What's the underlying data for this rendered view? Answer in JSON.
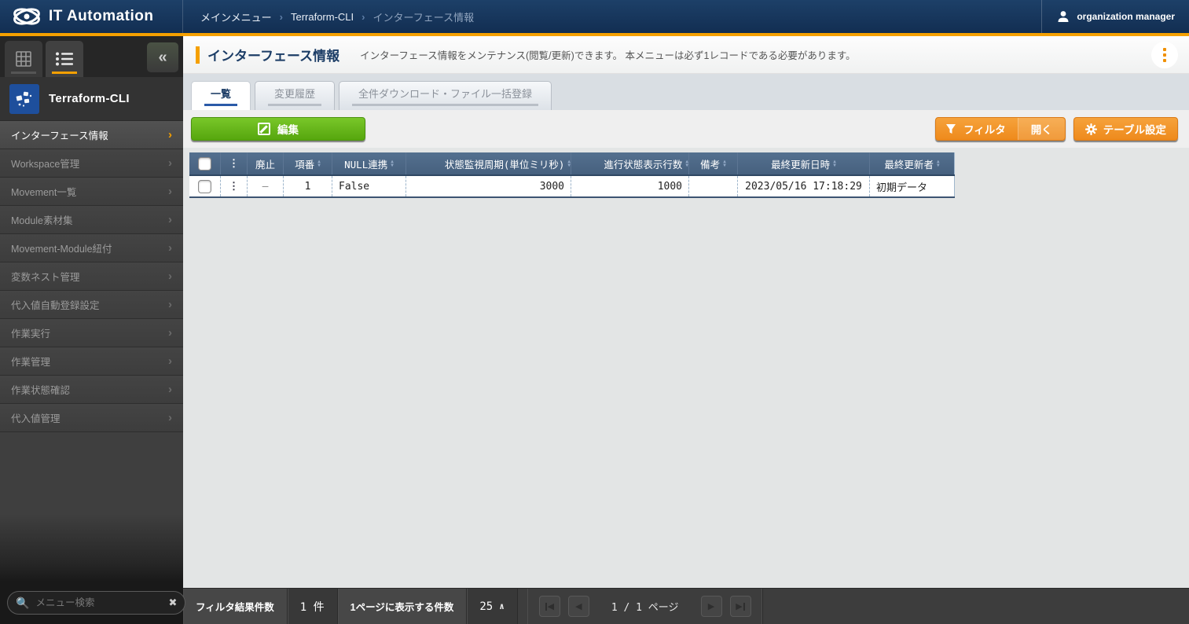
{
  "header": {
    "app_title": "IT Automation",
    "breadcrumb": {
      "item1": "メインメニュー",
      "item2": "Terraform-CLI",
      "item3": "インターフェース情報",
      "sep": "›"
    },
    "user_name": "organization manager"
  },
  "sidebar": {
    "workspace_title": "Terraform-CLI",
    "collapse_glyph": "«",
    "search_placeholder": "メニュー検索",
    "items": [
      {
        "label": "インターフェース情報"
      },
      {
        "label": "Workspace管理"
      },
      {
        "label": "Movement一覧"
      },
      {
        "label": "Module素材集"
      },
      {
        "label": "Movement-Module紐付"
      },
      {
        "label": "変数ネスト管理"
      },
      {
        "label": "代入値自動登録設定"
      },
      {
        "label": "作業実行"
      },
      {
        "label": "作業管理"
      },
      {
        "label": "作業状態確認"
      },
      {
        "label": "代入値管理"
      }
    ],
    "chevron": "›"
  },
  "page": {
    "title": "インターフェース情報",
    "description": "インターフェース情報をメンテナンス(閲覧/更新)できます。 本メニューは必ず1レコードである必要があります。",
    "tabs": [
      {
        "label": "一覧"
      },
      {
        "label": "変更履歴"
      },
      {
        "label": "全件ダウンロード・ファイル一括登録"
      }
    ],
    "edit_button": "編集",
    "filter_button": "フィルタ",
    "filter_open_button": "開く",
    "table_settings_button": "テーブル設定"
  },
  "table": {
    "columns": {
      "discard": "廃止",
      "no": "項番",
      "null_link": "NULL連携",
      "monitor_cycle": "状態監視周期(単位ミリ秒)",
      "progress_rows": "進行状態表示行数",
      "remarks": "備考",
      "last_update": "最終更新日時",
      "last_updater": "最終更新者"
    },
    "kebab_glyph": "⋮",
    "sort_up": "▲",
    "sort_down": "▼",
    "rows": [
      {
        "discard": "—",
        "no": "1",
        "null_link": "False",
        "monitor_cycle": "3000",
        "progress_rows": "1000",
        "remarks": "",
        "last_update": "2023/05/16 17:18:29",
        "last_updater": "初期データ"
      }
    ]
  },
  "footer": {
    "filter_result_label": "フィルタ結果件数",
    "filter_result_value": "1 件",
    "per_page_label": "1ページに表示する件数",
    "per_page_value": "25",
    "page_info": "1 / 1 ページ"
  },
  "colors": {
    "accent_orange": "#f5a000",
    "header_navy": "#1d4068",
    "button_green": "#56a60e",
    "button_orange": "#ee8a1c",
    "table_header_blue": "#46607e"
  }
}
